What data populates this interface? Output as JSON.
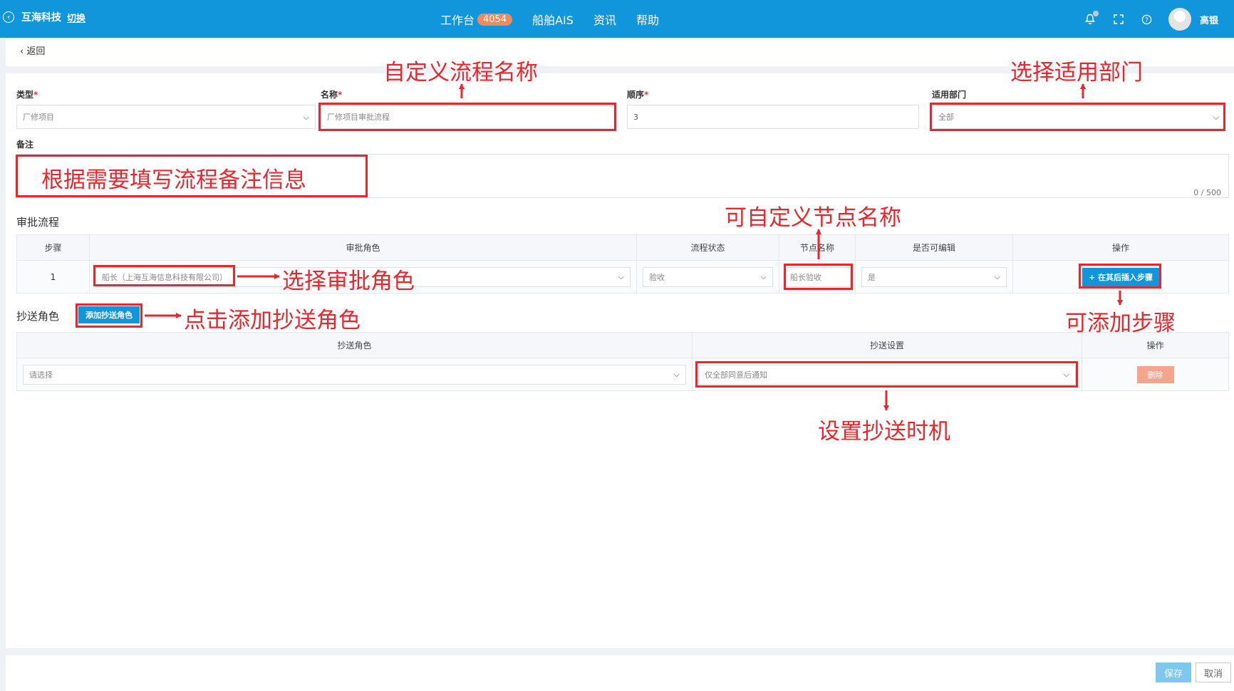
{
  "header": {
    "brand": "互海科技",
    "switch": "切换",
    "nav": [
      {
        "label": "工作台",
        "badge": "4054"
      },
      {
        "label": "船舶AIS"
      },
      {
        "label": "资讯"
      },
      {
        "label": "帮助"
      }
    ],
    "username": "高银"
  },
  "page": {
    "back_label": "返回"
  },
  "form": {
    "type": {
      "label": "类型",
      "value": "厂修项目"
    },
    "name": {
      "label": "名称",
      "placeholder": "厂修项目审批流程"
    },
    "order": {
      "label": "顺序",
      "value": "3"
    },
    "dept": {
      "label": "适用部门",
      "value": "全部"
    },
    "remark": {
      "label": "备注",
      "counter": "0 / 500"
    }
  },
  "approval": {
    "title": "审批流程",
    "headers": [
      "步骤",
      "审批角色",
      "流程状态",
      "节点名称",
      "是否可编辑",
      "操作"
    ],
    "rows": [
      {
        "step": "1",
        "role": "船长（上海互海信息科技有限公司）",
        "status": "验收",
        "node": "船长验收",
        "editable": "是",
        "action": "+ 在其后插入步骤"
      }
    ]
  },
  "cc": {
    "title": "抄送角色",
    "add_button": "添加抄送角色",
    "headers": [
      "抄送角色",
      "抄送设置",
      "操作"
    ],
    "rows": [
      {
        "role": "请选择",
        "setting": "仅全部同意后通知",
        "action": "删除"
      }
    ]
  },
  "footer": {
    "save": "保存",
    "cancel": "取消"
  },
  "annotations": {
    "name": "自定义流程名称",
    "dept": "选择适用部门",
    "remark": "根据需要填写流程备注信息",
    "node": "可自定义节点名称",
    "role": "选择审批角色",
    "add_step": "可添加步骤",
    "add_cc": "点击添加抄送角色",
    "cc_timing": "设置抄送时机"
  },
  "colors": {
    "header_bg": "#1296db",
    "annotation": "#e8262c",
    "badge": "#f08a5d",
    "delete_btn": "#f5a48e"
  }
}
